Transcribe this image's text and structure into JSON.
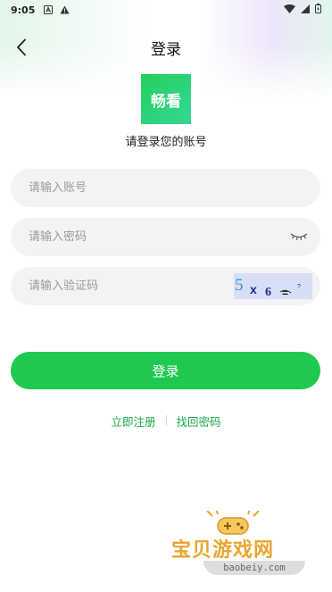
{
  "status_bar": {
    "time": "9:05",
    "left_icons": [
      "notification-a-icon",
      "warning-icon"
    ],
    "right_icons": [
      "wifi-icon",
      "signal-icon",
      "battery-icon"
    ]
  },
  "header": {
    "title": "登录",
    "back_icon": "chevron-left-icon"
  },
  "logo": {
    "text": "畅看",
    "colors": [
      "#22cf5a",
      "#35d896"
    ]
  },
  "subtitle": "请登录您的账号",
  "form": {
    "account": {
      "placeholder": "请输入账号",
      "value": ""
    },
    "password": {
      "placeholder": "请输入密码",
      "value": "",
      "toggle_icon": "eye-closed-icon"
    },
    "captcha": {
      "placeholder": "请输入验证码",
      "value": "",
      "image_text": "5 x 6 =?"
    }
  },
  "login_button": "登录",
  "links": {
    "register": "立即注册",
    "forgot": "找回密码"
  },
  "watermark": {
    "title": "宝贝游戏网",
    "url": "baobeiy.com"
  },
  "colors": {
    "accent": "#1fc94f",
    "link": "#1aa84a",
    "field_bg": "#f3f3f5"
  }
}
